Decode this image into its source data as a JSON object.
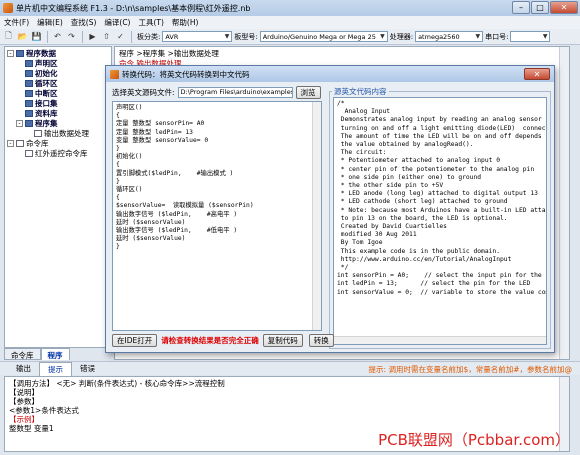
{
  "window": {
    "title": "单片机中文编程系统 F1.3 - D:\\n\\samples\\基本例程\\红外遥控.nb",
    "min": "–",
    "max": "□",
    "close": "✕"
  },
  "menu": [
    "文件(F)",
    "编辑(E)",
    "查找(S)",
    "编译(C)",
    "工具(T)",
    "帮助(H)"
  ],
  "toolbar": {
    "board_family_label": "板分类:",
    "board_family": "AVR",
    "board_label": "板型号:",
    "board": "Arduino/Genuino Mega or Mega 25",
    "cpu_label": "处理器:",
    "cpu": "atmega2560",
    "port_label": "串口号:",
    "port": ""
  },
  "tree": [
    {
      "label": "程序数据",
      "bold": true,
      "expander": "-",
      "indent": 0
    },
    {
      "label": "声明区",
      "bold": true,
      "expander": "",
      "indent": 1
    },
    {
      "label": "初始化",
      "bold": true,
      "expander": "",
      "indent": 1
    },
    {
      "label": "循环区",
      "bold": true,
      "expander": "",
      "indent": 1
    },
    {
      "label": "中断区",
      "bold": true,
      "expander": "",
      "indent": 1
    },
    {
      "label": "接口集",
      "bold": true,
      "expander": "",
      "indent": 1
    },
    {
      "label": "资料库",
      "bold": true,
      "expander": "",
      "indent": 1
    },
    {
      "label": "程序集",
      "bold": true,
      "expander": "-",
      "indent": 1
    },
    {
      "label": "输出数据处理",
      "bold": false,
      "expander": "",
      "indent": 2
    },
    {
      "label": "命令库",
      "bold": false,
      "expander": "-",
      "indent": 0
    },
    {
      "label": "红外遥控命令库",
      "bold": false,
      "expander": "",
      "indent": 1
    }
  ],
  "left_tabs": [
    "命令库",
    "程序"
  ],
  "editor": {
    "breadcrumb": "程序 >程序集 >输出数据处理",
    "tab": "命令    输出数据处理"
  },
  "dialog": {
    "title": "转换代码：将英文代码转换到中文代码",
    "close": "✕",
    "file_label": "选择英文源码文件:",
    "file_path": "D:\\Program Files\\arduino\\examples",
    "browse": "浏览",
    "preview_label": "源英文代码内容",
    "left_code": [
      "声明区()",
      "{",
      "",
      "定量 整数型 sensorPin= A0",
      "定量 整数型 ledPin= 13",
      "变量 整数型 sensorValue= 0",
      "",
      "}",
      "初始化()",
      "{",
      "",
      "置引脚模式($ledPin,    #输出模式 )",
      "",
      "}",
      "循环区()",
      "{",
      "$sensorValue=  读取模拟量 ($sensorPin)",
      "",
      "输出数字信号 ($ledPin,    #高电平 )",
      "",
      "延时 ($sensorValue)",
      "",
      "输出数字信号 ($ledPin,    #低电平 )",
      "",
      "延时 ($sensorValue)",
      "",
      "}"
    ],
    "right_code": [
      "/*",
      "  Analog Input",
      " Demonstrates analog input by reading an analog sensor on",
      " turning on and off a light emitting diode(LED)  connected",
      " The amount of time the LED will be on and off depends on",
      " the value obtained by analogRead().",
      "",
      " The circuit:",
      " * Potentiometer attached to analog input 0",
      " * center pin of the potentiometer to the analog pin",
      " * one side pin (either one) to ground",
      " * the other side pin to +5V",
      " * LED anode (long leg) attached to digital output 13",
      " * LED cathode (short leg) attached to ground",
      "",
      " * Note: because most Arduinos have a built-in LED attach",
      " to pin 13 on the board, the LED is optional.",
      "",
      "",
      " Created by David Cuartielles",
      " modified 30 Aug 2011",
      " By Tom Igoe",
      "",
      " This example code is in the public domain.",
      "",
      " http://www.arduino.cc/en/Tutorial/AnalogInput",
      "",
      " */",
      "",
      "int sensorPin = A0;    // select the input pin for the po",
      "int ledPin = 13;      // select the pin for the LED",
      "int sensorValue = 0;  // variable to store the value comi"
    ],
    "ide_open": "在IDE打开",
    "warning": "请检查转换结果是否完全正确",
    "copy": "复制代码",
    "convert": "转换"
  },
  "bottom_tabs": [
    "输出",
    "提示",
    "错误"
  ],
  "hint": "提示: 调用时需在变量名前加$，常量名前加#，参数名前加@",
  "bottom_lines": [
    {
      "text": "【调用方法】 <无> 判断(条件表达式)  -  核心命令库>>流程控制",
      "red": false
    },
    {
      "text": "【说明】",
      "red": false
    },
    {
      "text": "",
      "red": false
    },
    {
      "text": "【参数】",
      "red": false
    },
    {
      "text": "<参数1>条件表达式",
      "red": false
    },
    {
      "text": "【示例】",
      "red": true
    },
    {
      "text": "整数型 变量1",
      "red": false
    }
  ],
  "watermark": "PCB联盟网（Pcbbar.com）"
}
